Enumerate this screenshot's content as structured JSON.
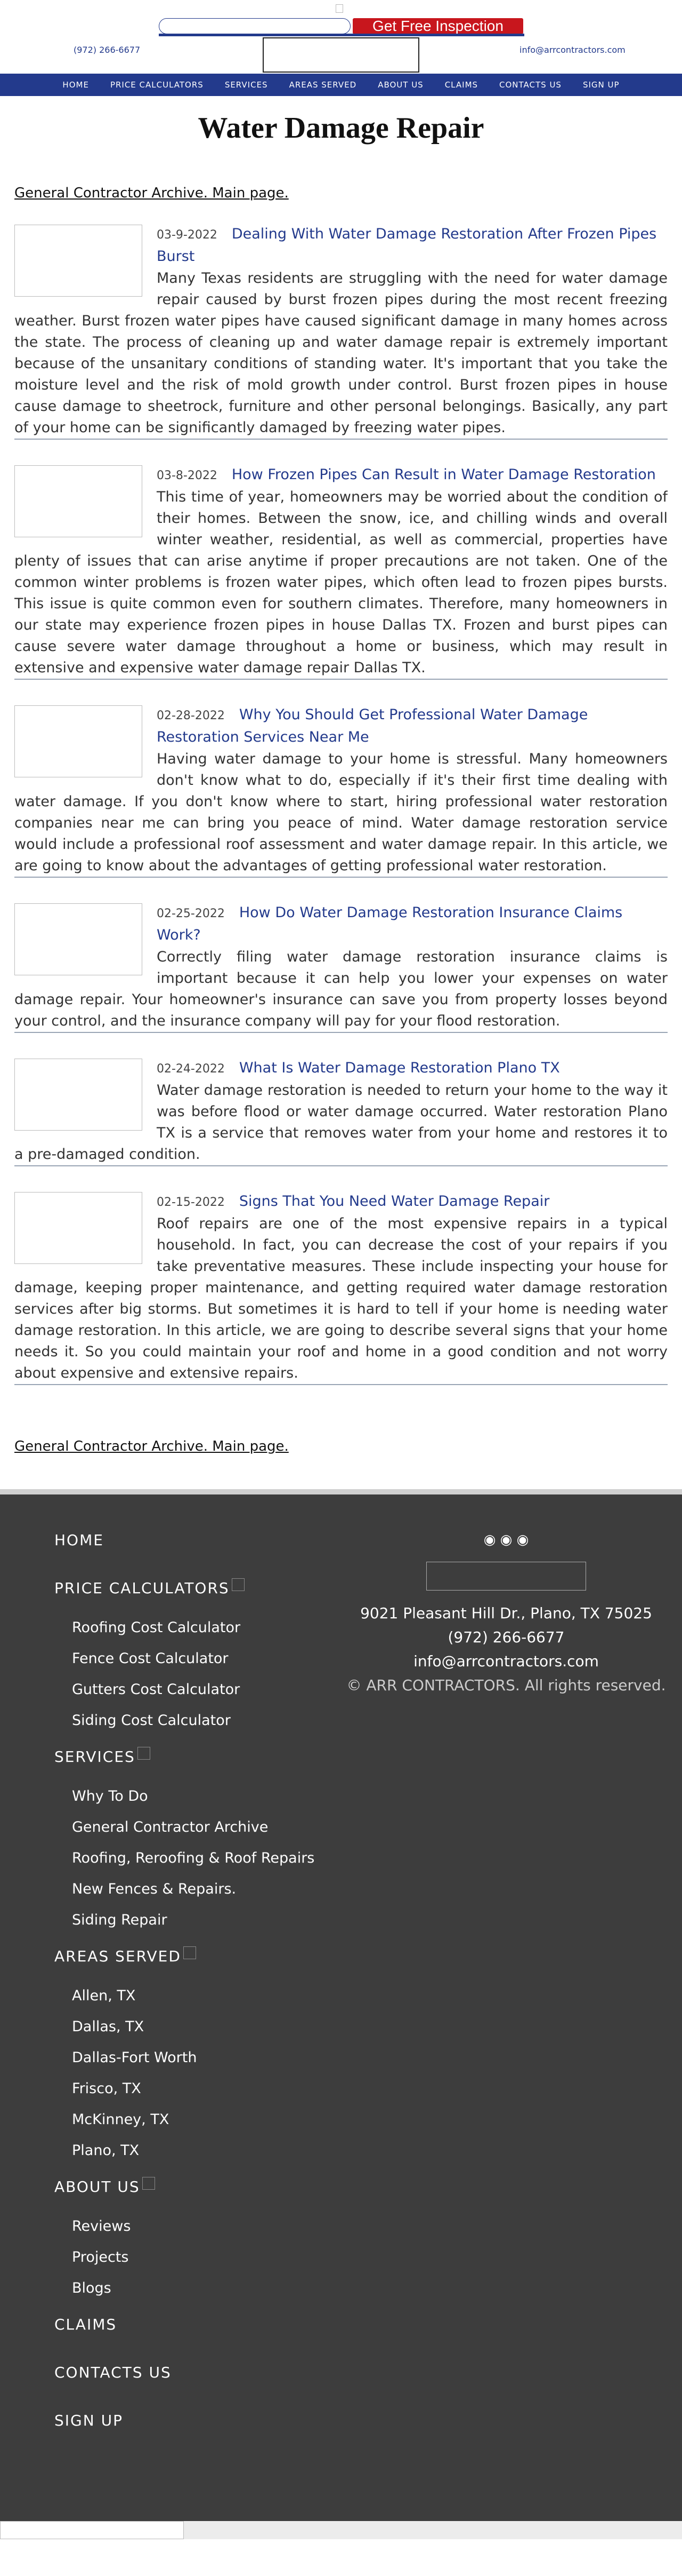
{
  "header": {
    "cta_label": "Get Free Inspection",
    "phone": "(972) 266-6677",
    "email": "info@arrcontractors.com",
    "nav": [
      "HOME",
      "PRICE CALCULATORS",
      "SERVICES",
      "AREAS SERVED",
      "ABOUT US",
      "CLAIMS",
      "CONTACTS US",
      "SIGN UP"
    ]
  },
  "page": {
    "title": "Water Damage Repair",
    "archive_link": "General Contractor Archive. Main page."
  },
  "posts": [
    {
      "date": "03-9-2022",
      "title": "Dealing With Water Damage Restoration After Frozen Pipes Burst",
      "excerpt": "Many Texas residents are struggling with the need for water damage repair caused by burst frozen pipes during the most recent freezing weather. Burst frozen water pipes have caused significant damage in many homes across the state. The process of cleaning up and water damage repair is extremely important because of the unsanitary conditions of standing water. It's important that you take the moisture level and the risk of mold growth under control. Burst frozen pipes in house cause damage to sheetrock, furniture and other personal belongings. Basically, any part of your home can be significantly damaged by freezing water pipes."
    },
    {
      "date": "03-8-2022",
      "title": "How Frozen Pipes Can Result in Water Damage Restoration",
      "excerpt": "This time of year, homeowners may be worried about the condition of their homes. Between the snow, ice, and chilling winds and overall winter weather, residential, as well as commercial, properties have plenty of issues that can arise anytime if proper precautions are not taken. One of the common winter problems is frozen water pipes, which often lead to frozen pipes bursts. This issue is quite common even for southern climates. Therefore, many homeowners in our state may experience frozen pipes in house Dallas TX. Frozen and burst pipes can cause severe water damage throughout a home or business, which may result in extensive and expensive water damage repair Dallas TX."
    },
    {
      "date": "02-28-2022",
      "title": "Why You Should Get Professional Water Damage Restoration Services Near Me",
      "excerpt": "Having water damage to your home is stressful. Many homeowners don't know what to do, especially if it's their first time dealing with water damage. If you don't know where to start, hiring professional water restoration companies near me can bring you peace of mind. Water damage restoration service would include a professional roof assessment and water damage repair. In this article, we are going to know about the advantages of getting professional water restoration."
    },
    {
      "date": "02-25-2022",
      "title": "How Do Water Damage Restoration Insurance Claims Work?",
      "excerpt": "Correctly filing water damage restoration insurance claims is important because it can help you lower your expenses on water damage repair. Your homeowner's insurance can save you from property losses beyond your control, and the insurance company will pay for your flood restoration."
    },
    {
      "date": "02-24-2022",
      "title": "What Is Water Damage Restoration Plano TX",
      "excerpt": "Water damage restoration is needed to return your home to the way it was before flood or water damage occurred. Water restoration Plano TX is a service that removes water from your home and restores it to a pre-damaged condition."
    },
    {
      "date": "02-15-2022",
      "title": "Signs That You Need Water Damage Repair",
      "excerpt": "Roof repairs are one of the most expensive repairs in a typical household. In fact, you can decrease the cost of your repairs if you take preventative measures. These include inspecting your house for damage, keeping proper maintenance, and getting required water damage restoration services after big storms. But sometimes it is hard to tell if your home is needing water damage restoration. In this article, we are going to describe several signs that your home needs it. So you could maintain your roof and home in a good condition and not worry about expensive and extensive repairs."
    }
  ],
  "footer": {
    "nav": [
      {
        "label": "HOME",
        "has_caret": false,
        "children": []
      },
      {
        "label": "PRICE CALCULATORS",
        "has_caret": true,
        "children": [
          "Roofing Cost Calculator",
          "Fence Cost Calculator",
          "Gutters Cost Calculator",
          "Siding Cost Calculator"
        ]
      },
      {
        "label": "SERVICES",
        "has_caret": true,
        "children": [
          "Why To Do",
          "General Contractor Archive",
          "Roofing, Reroofing & Roof Repairs",
          "New Fences & Repairs.",
          "Siding Repair"
        ]
      },
      {
        "label": "AREAS SERVED",
        "has_caret": true,
        "children": [
          "Allen, TX",
          "Dallas, TX",
          "Dallas-Fort Worth",
          "Frisco, TX",
          "McKinney, TX",
          "Plano, TX"
        ]
      },
      {
        "label": "ABOUT US",
        "has_caret": true,
        "children": [
          "Reviews",
          "Projects",
          "Blogs"
        ]
      },
      {
        "label": "CLAIMS",
        "has_caret": false,
        "children": []
      },
      {
        "label": "CONTACTS US",
        "has_caret": false,
        "children": []
      },
      {
        "label": "SIGN UP",
        "has_caret": false,
        "children": []
      }
    ],
    "address": "9021 Pleasant Hill Dr., Plano, TX 75025",
    "phone": "(972) 266-6677",
    "email": "info@arrcontractors.com",
    "copyright": "© ARR CONTRACTORS. All rights reserved."
  },
  "colors": {
    "brand_blue": "#233a8c",
    "cta_red": "#c8161d",
    "footer_bg": "#3d3d3d"
  }
}
